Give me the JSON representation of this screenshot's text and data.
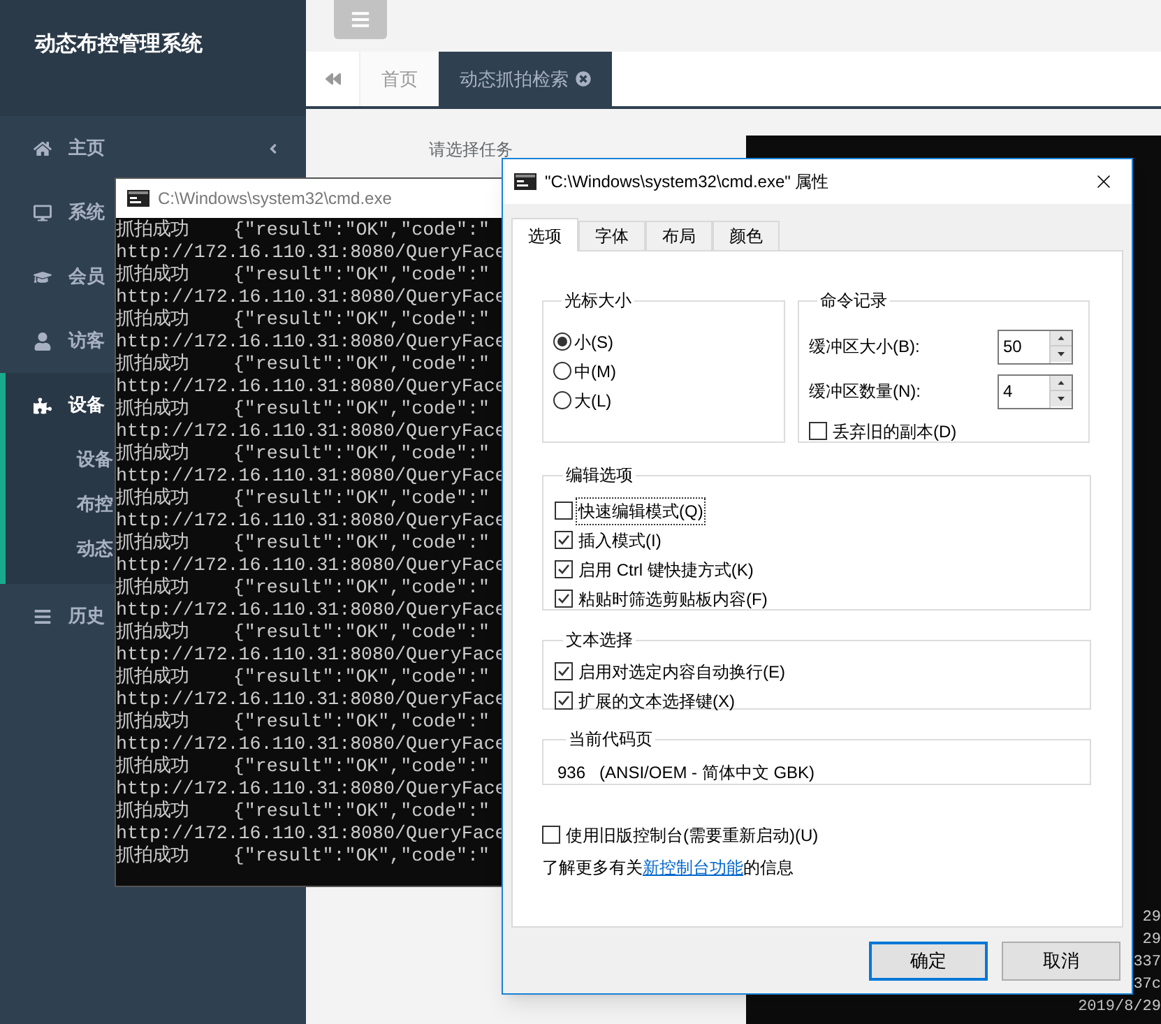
{
  "sidebar": {
    "title": "动态布控管理系统",
    "items": [
      {
        "label": "主页",
        "arrow": true,
        "expanded": false
      },
      {
        "label": "系统",
        "arrow": false,
        "expanded": false
      },
      {
        "label": "会员",
        "arrow": false,
        "expanded": false
      },
      {
        "label": "访客",
        "arrow": false,
        "expanded": false
      },
      {
        "label": "设备",
        "arrow": false,
        "expanded": true,
        "children": [
          {
            "label": "设备"
          },
          {
            "label": "布控"
          },
          {
            "label": "动态"
          }
        ]
      },
      {
        "label": "历史",
        "arrow": false,
        "expanded": false
      }
    ]
  },
  "tabs": [
    {
      "label": "首页",
      "selected": false
    },
    {
      "label": "动态抓拍检索",
      "selected": true
    }
  ],
  "content": {
    "prompt": "请选择任务"
  },
  "back_console": {
    "lines": [
      "29",
      "29",
      "337",
      "37c",
      "2019/8/29"
    ]
  },
  "cmd_window": {
    "title": "C:\\Windows\\system32\\cmd.exe",
    "lines": [
      "抓拍成功    {\"result\":\"OK\",\"code\":\"",
      "http://172.16.110.31:8080/QueryFace",
      "抓拍成功    {\"result\":\"OK\",\"code\":\"",
      "http://172.16.110.31:8080/QueryFace",
      "抓拍成功    {\"result\":\"OK\",\"code\":\"",
      "http://172.16.110.31:8080/QueryFace",
      "抓拍成功    {\"result\":\"OK\",\"code\":\"",
      "http://172.16.110.31:8080/QueryFace",
      "抓拍成功    {\"result\":\"OK\",\"code\":\"",
      "http://172.16.110.31:8080/QueryFace",
      "抓拍成功    {\"result\":\"OK\",\"code\":\"",
      "http://172.16.110.31:8080/QueryFace",
      "抓拍成功    {\"result\":\"OK\",\"code\":\"",
      "http://172.16.110.31:8080/QueryFace",
      "抓拍成功    {\"result\":\"OK\",\"code\":\"",
      "http://172.16.110.31:8080/QueryFace",
      "抓拍成功    {\"result\":\"OK\",\"code\":\"",
      "http://172.16.110.31:8080/QueryFace",
      "抓拍成功    {\"result\":\"OK\",\"code\":\"",
      "http://172.16.110.31:8080/QueryFace",
      "抓拍成功    {\"result\":\"OK\",\"code\":\"",
      "http://172.16.110.31:8080/QueryFace",
      "抓拍成功    {\"result\":\"OK\",\"code\":\"",
      "http://172.16.110.31:8080/QueryFace",
      "抓拍成功    {\"result\":\"OK\",\"code\":\"",
      "http://172.16.110.31:8080/QueryFace",
      "抓拍成功    {\"result\":\"OK\",\"code\":\"",
      "http://172.16.110.31:8080/QueryFace",
      "抓拍成功    {\"result\":\"OK\",\"code\":\""
    ]
  },
  "dialog": {
    "title": "\"C:\\Windows\\system32\\cmd.exe\" 属性",
    "tabs": [
      {
        "label": "选项",
        "selected": true
      },
      {
        "label": "字体",
        "selected": false
      },
      {
        "label": "布局",
        "selected": false
      },
      {
        "label": "颜色",
        "selected": false
      }
    ],
    "cursor_size": {
      "title": "光标大小",
      "options": [
        {
          "label": "小(S)",
          "selected": true
        },
        {
          "label": "中(M)",
          "selected": false
        },
        {
          "label": "大(L)",
          "selected": false
        }
      ]
    },
    "history": {
      "title": "命令记录",
      "fields": [
        {
          "label": "缓冲区大小(B):",
          "value": "50"
        },
        {
          "label": "缓冲区数量(N):",
          "value": "4"
        }
      ],
      "discard": {
        "label": "丢弃旧的副本(D)",
        "checked": false
      }
    },
    "edit_options": {
      "title": "编辑选项",
      "items": [
        {
          "label": "快速编辑模式(Q)",
          "checked": false,
          "focused": true
        },
        {
          "label": "插入模式(I)",
          "checked": true,
          "focused": false
        },
        {
          "label": "启用 Ctrl 键快捷方式(K)",
          "checked": true,
          "focused": false
        },
        {
          "label": "粘贴时筛选剪贴板内容(F)",
          "checked": true,
          "focused": false
        }
      ]
    },
    "text_selection": {
      "title": "文本选择",
      "items": [
        {
          "label": "启用对选定内容自动换行(E)",
          "checked": true,
          "focused": false
        },
        {
          "label": "扩展的文本选择键(X)",
          "checked": true,
          "focused": false
        }
      ]
    },
    "code_page": {
      "title": "当前代码页",
      "value": "936   (ANSI/OEM - 简体中文 GBK)"
    },
    "legacy": {
      "label": "使用旧版控制台(需要重新启动)(U)",
      "checked": false
    },
    "info": {
      "before": "了解更多有关",
      "link": "新控制台功能",
      "after": "的信息"
    },
    "buttons": [
      {
        "label": "确定",
        "default": true
      },
      {
        "label": "取消",
        "default": false
      }
    ]
  }
}
